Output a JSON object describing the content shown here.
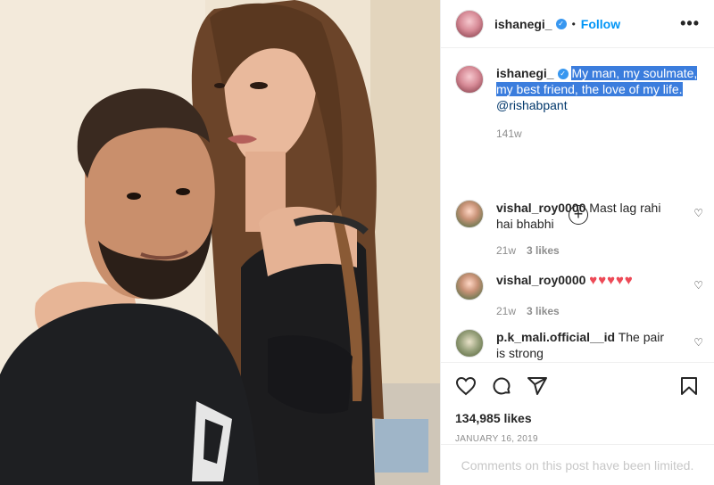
{
  "post": {
    "username": "ishanegi_",
    "verified_mark": "✓",
    "separator": "•",
    "follow_label": "Follow",
    "more_label": "•••"
  },
  "caption": {
    "username": "ishanegi_",
    "text": "My man, my soulmate, my best friend, the love of my life.",
    "mention": "@rishabpant",
    "age": "141w"
  },
  "load_more_label": "+",
  "comments": [
    {
      "username": "vishal_roy0000",
      "text": "Mast lag rahi hai bhabhi",
      "age": "21w",
      "likes": "3 likes"
    },
    {
      "username": "vishal_roy0000",
      "text": "♥♥♥♥♥",
      "age": "21w",
      "likes": "3 likes"
    },
    {
      "username": "p.k_mali.official__id",
      "text": "The pair is strong"
    }
  ],
  "actions": {
    "like_icon": "heart-icon",
    "comment_icon": "comment-icon",
    "share_icon": "share-icon",
    "save_icon": "bookmark-icon"
  },
  "likes_count": "134,985 likes",
  "date": "JANUARY 16, 2019",
  "limited_notice": "Comments on this post have been limited.",
  "colors": {
    "accent": "#0095f6",
    "verified": "#3897f0",
    "heart_red": "#ed4956",
    "selection": "#3b7ddd"
  }
}
